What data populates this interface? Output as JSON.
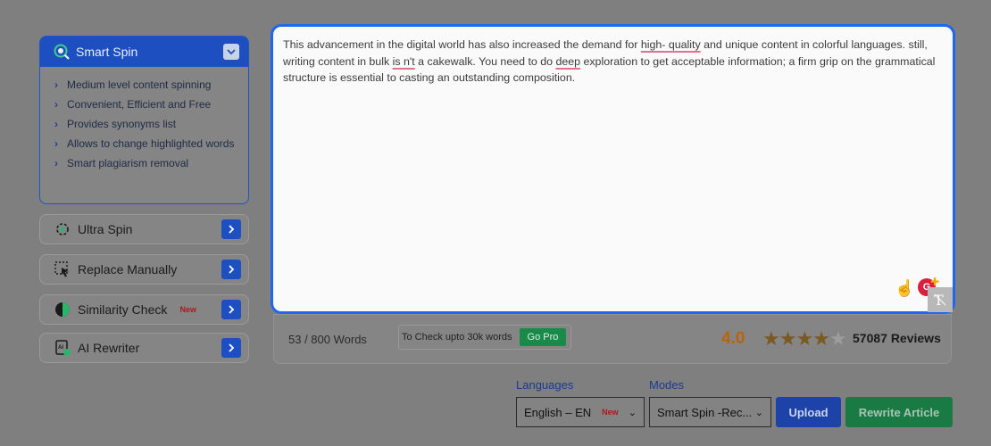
{
  "sidebar": {
    "smart_spin": {
      "title": "Smart Spin",
      "features": [
        "Medium level content spinning",
        "Convenient, Efficient and Free",
        "Provides synonyms list",
        "Allows to change highlighted words",
        "Smart plagiarism removal"
      ]
    },
    "tools": [
      {
        "label": "Ultra Spin",
        "icon": "ultra-spin-icon"
      },
      {
        "label": "Replace Manually",
        "icon": "replace-manually-icon"
      },
      {
        "label": "Similarity Check",
        "icon": "similarity-check-icon",
        "badge": "New"
      },
      {
        "label": "AI Rewriter",
        "icon": "ai-rewriter-icon"
      }
    ]
  },
  "editor": {
    "p1": "This advancement in the digital world has also increased the demand for ",
    "w1": "high- quality",
    "p2": " and unique content in colorful languages. still, writing content in bulk ",
    "w2": "is n't",
    "p3": " a cakewalk. You need to do ",
    "w3": "deep",
    "p4": " exploration to get acceptable information; a firm grip on the grammatical structure is essential to casting an outstanding composition.",
    "grammar_badge": "G"
  },
  "stats": {
    "word_count": "53 / 800 Words",
    "check_text": "To Check upto 30k words",
    "go_pro": "Go Pro",
    "rating": "4.0",
    "stars_filled": 4,
    "stars_total": 5,
    "reviews": "57087 Reviews"
  },
  "controls": {
    "languages_label": "Languages",
    "language_value": "English – EN",
    "language_badge": "New",
    "modes_label": "Modes",
    "mode_value": "Smart Spin -Rec...",
    "upload": "Upload",
    "rewrite": "Rewrite Article"
  },
  "colors": {
    "accent_blue": "#1f66f0",
    "button_blue": "#1d43a8",
    "button_green": "#1a7a44",
    "rating_orange": "#b8640a"
  }
}
